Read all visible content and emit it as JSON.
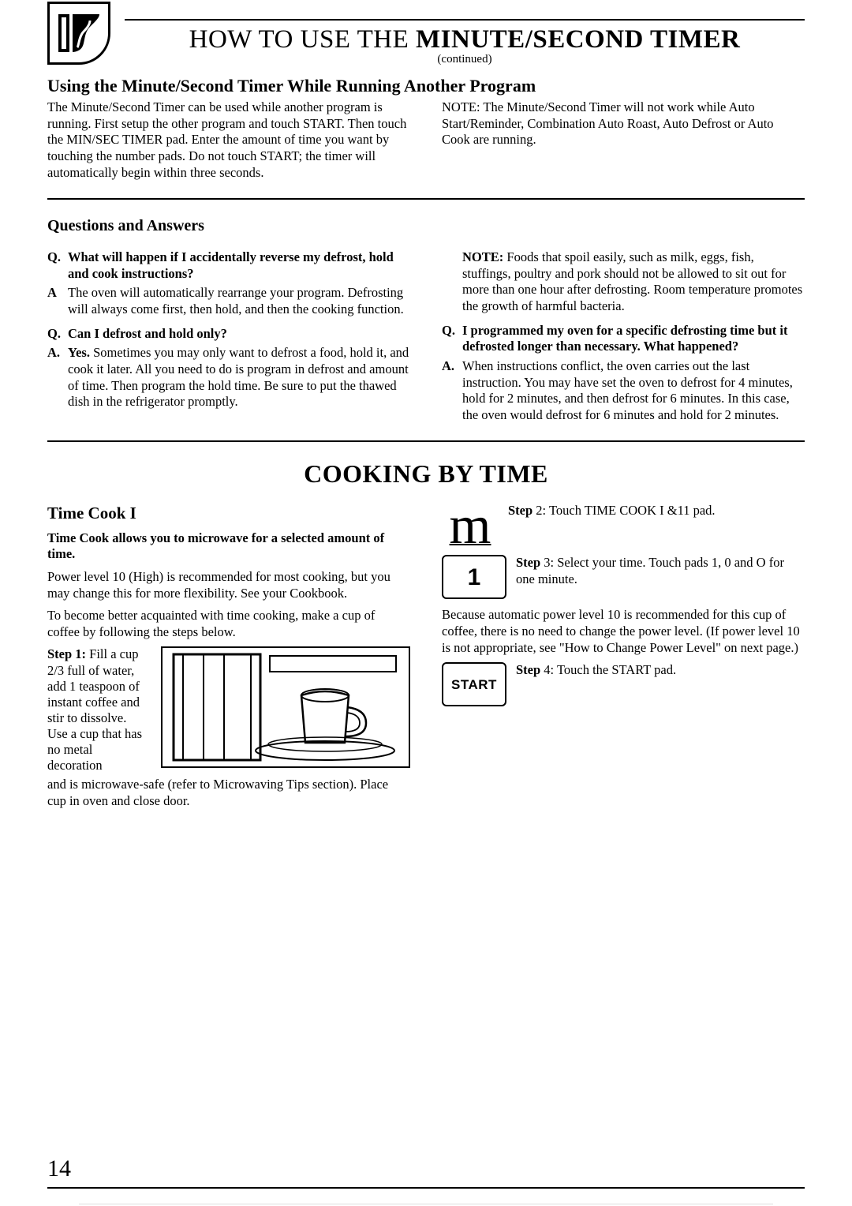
{
  "header": {
    "title_pre": "HOW TO USE THE ",
    "title_bold": "MINUTE/SECOND TIMER",
    "continued": "(continued)"
  },
  "sec1": {
    "heading": "Using the Minute/Second Timer While Running Another Program",
    "left": "The Minute/Second Timer can be used while another program is running. First setup the other program and touch START. Then touch the MIN/SEC TIMER pad. Enter the amount of time you want by touching the number pads. Do not touch START; the timer will automatically begin within three seconds.",
    "right": "NOTE: The Minute/Second Timer will not work while Auto Start/Reminder, Combination Auto Roast, Auto Defrost or Auto Cook are running."
  },
  "qa": {
    "heading": "Questions and Answers",
    "q1": "What will happen if I accidentally reverse my defrost, hold and cook instructions?",
    "a1": "The oven will automatically rearrange your program. Defrosting will always come first, then hold, and then the cooking function.",
    "q2": "Can I defrost and hold only?",
    "a2_lead": "Yes.",
    "a2": " Sometimes you may only want to defrost a food, hold it, and cook it later. All you need to do is program in defrost and amount of time. Then program the hold time. Be sure to put the thawed dish in the refrigerator promptly.",
    "note_lead": "NOTE:",
    "note": " Foods that spoil easily, such as milk, eggs, fish, stuffings, poultry and pork should not be allowed to sit out for more than one hour after defrosting. Room temperature promotes the growth of harmful bacteria.",
    "q3": "I programmed my oven for a specific defrosting time but it defrosted longer than necessary. What happened?",
    "a3": "When instructions conflict, the oven carries out the last instruction. You may have set the oven to defrost for 4 minutes, hold for 2 minutes, and then defrost for 6 minutes. In this case, the oven would defrost for 6 minutes and hold for 2 minutes."
  },
  "cbt": {
    "title": "COOKING BY TIME",
    "sub": "Time Cook I",
    "lead": "Time Cook allows you to microwave for a selected amount of time.",
    "p1": "Power level 10 (High) is recommended for most cooking, but you may change this for more flexibility. See your Cookbook.",
    "p2": "To become better acquainted with time cooking, make a cup of coffee by following the steps below.",
    "step1_label": "Step 1:",
    "step1_text": " Fill a cup 2/3 full of water, add 1 teaspoon of instant coffee and stir to dissolve. Use a cup that has no metal decoration",
    "step1_caption": "and is microwave-safe (refer to Microwaving Tips section). Place cup in oven and close door.",
    "step2_label": "Step",
    "step2_text": " 2: Touch TIME COOK I &11 pad.",
    "step3_label": "Step",
    "step3_text": " 3: Select your time. Touch pads 1, 0 and O for one minute.",
    "between": "Because automatic power level 10 is recommended for this cup of coffee, there is no need to change the power level. (If power level 10 is not appropriate, see \"How to Change Power Level\" on next page.)",
    "step4_label": "Step",
    "step4_text": " 4: Touch the START pad.",
    "pad1": "1",
    "padStart": "START"
  },
  "pageNum": "14"
}
